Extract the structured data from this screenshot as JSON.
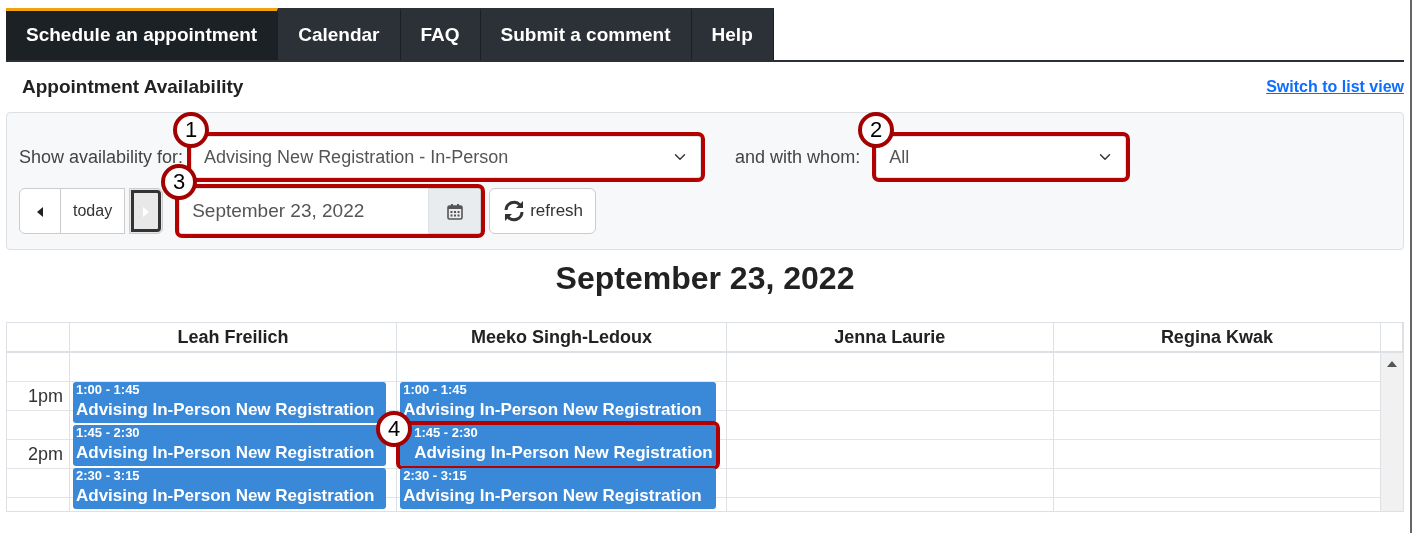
{
  "tabs": [
    {
      "label": "Schedule an appointment",
      "selected": true
    },
    {
      "label": "Calendar",
      "selected": false
    },
    {
      "label": "FAQ",
      "selected": false
    },
    {
      "label": "Submit a comment",
      "selected": false
    },
    {
      "label": "Help",
      "selected": false
    }
  ],
  "heading": "Appointment Availability",
  "switch_link": "Switch to list view",
  "filters": {
    "service": {
      "label": "Show availability for:",
      "value": "Advising New Registration - In-Person",
      "callout": "1"
    },
    "staff": {
      "label": "and with whom:",
      "value": "All",
      "callout": "2"
    }
  },
  "date_nav": {
    "today": "today",
    "next_disabled": true,
    "date": "September 23, 2022",
    "date_callout": "3",
    "refresh": "refresh"
  },
  "day_title": "September 23, 2022",
  "calendar": {
    "hours": [
      {
        "label": "1pm"
      },
      {
        "label": "2pm"
      }
    ],
    "columns": [
      {
        "name": "Leah Freilich",
        "events": [
          {
            "time": "1:00 - 1:45",
            "title": "Advising In-Person New Registration"
          },
          {
            "time": "1:45 - 2:30",
            "title": "Advising In-Person New Registration"
          },
          {
            "time": "2:30 - 3:15",
            "title": "Advising In-Person New Registration"
          }
        ]
      },
      {
        "name": "Meeko Singh-Ledoux",
        "events": [
          {
            "time": "1:00 - 1:45",
            "title": "Advising In-Person New Registration"
          },
          {
            "time": "1:45 - 2:30",
            "title": "Advising In-Person New Registration",
            "callout": "4"
          },
          {
            "time": "2:30 - 3:15",
            "title": "Advising In-Person New Registration"
          }
        ]
      },
      {
        "name": "Jenna Laurie"
      },
      {
        "name": "Regina Kwak"
      }
    ]
  }
}
